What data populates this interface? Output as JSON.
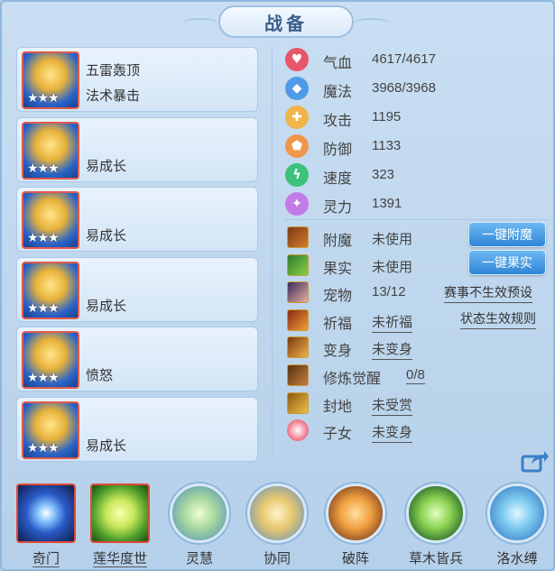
{
  "window": {
    "title": "战备"
  },
  "equipment": [
    {
      "line1": "五雷轰顶",
      "line2": "法术暴击",
      "stars": "★★★"
    },
    {
      "line1": "",
      "line2": "易成长",
      "stars": "★★★"
    },
    {
      "line1": "",
      "line2": "易成长",
      "stars": "★★★"
    },
    {
      "line1": "",
      "line2": "易成长",
      "stars": "★★★"
    },
    {
      "line1": "",
      "line2": "愤怒",
      "stars": "★★★"
    },
    {
      "line1": "",
      "line2": "易成长",
      "stars": "★★★"
    }
  ],
  "stats": [
    {
      "label": "气血",
      "value": "4617/4617",
      "icon": "heart-icon",
      "color": "#e8566c"
    },
    {
      "label": "魔法",
      "value": "3968/3968",
      "icon": "mana-icon",
      "color": "#4f9be8"
    },
    {
      "label": "攻击",
      "value": "1195",
      "icon": "sword-icon",
      "color": "#f0b44a"
    },
    {
      "label": "防御",
      "value": "1133",
      "icon": "shield-icon",
      "color": "#f0964a"
    },
    {
      "label": "速度",
      "value": "323",
      "icon": "speed-icon",
      "color": "#3cc27a"
    },
    {
      "label": "灵力",
      "value": "1391",
      "icon": "spirit-icon",
      "color": "#c27ae8"
    }
  ],
  "misc": [
    {
      "label": "附魔",
      "value": "未使用",
      "icon": "enchant-icon"
    },
    {
      "label": "果实",
      "value": "未使用",
      "icon": "fruit-icon"
    },
    {
      "label": "宠物",
      "value": "13/12",
      "icon": "pet-icon"
    },
    {
      "label": "祈福",
      "value": "未祈福",
      "icon": "pray-icon"
    },
    {
      "label": "变身",
      "value": "未变身",
      "icon": "transform-icon"
    },
    {
      "label": "修炼觉醒",
      "value": "0/8",
      "icon": "cultivate-icon"
    },
    {
      "label": "封地",
      "value": "未受赏",
      "icon": "fief-icon"
    },
    {
      "label": "子女",
      "value": "未变身",
      "icon": "child-icon"
    }
  ],
  "buttons": {
    "enchant": "一键附魔",
    "fruit": "一键果实"
  },
  "links": {
    "event_preset": "赛事不生效预设",
    "status_rule": "状态生效规则"
  },
  "skills": [
    {
      "label": "奇门",
      "shape": "square"
    },
    {
      "label": "莲华度世",
      "shape": "square"
    },
    {
      "label": "灵慧",
      "shape": "circle"
    },
    {
      "label": "协同",
      "shape": "circle"
    },
    {
      "label": "破阵",
      "shape": "circle"
    },
    {
      "label": "草木皆兵",
      "shape": "circle"
    },
    {
      "label": "洛水缚",
      "shape": "circle"
    }
  ],
  "colors": {
    "accent_blue": "#2f86d6",
    "frame_red": "#e04a3a"
  }
}
